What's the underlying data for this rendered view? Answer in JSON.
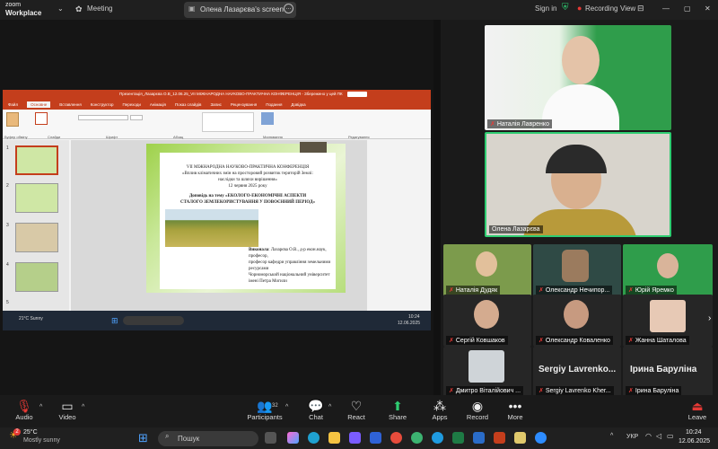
{
  "app": {
    "logo_line1": "zoom",
    "logo_line2": "Workplace",
    "meeting_label": "Meeting"
  },
  "topbar": {
    "share_label": "Олена Лазарєва's screen",
    "signin": "Sign in",
    "recording": "Recording",
    "view": "View"
  },
  "ppt": {
    "titlebar": "Презентація_Лазарєва О.В_12.06.25_VII МІЖНАРОДНА НАУКОВО-ПРАКТИЧНА КОНФЕРЕНЦІЯ - Збережено у цей ПК",
    "tabs": [
      "Файл",
      "Основне",
      "Вставлення",
      "Конструктор",
      "Переходи",
      "Анімація",
      "Показ слайдів",
      "Запис",
      "Рецензування",
      "Подання",
      "Довідка"
    ],
    "ribbon_groups": [
      "Буфер обміну",
      "Слайди",
      "Шрифт",
      "Абзац",
      "Малювання",
      "Редагування"
    ],
    "notes": "Нотатки до слайда",
    "status": "Слайд 1 з 27   Українська",
    "zoom": "62%",
    "slide": {
      "line1": "VII МІЖНАРОДНА НАУКОВО-ПРАКТИЧНА КОНФЕРЕНЦІЯ",
      "line2": "«Вплив кліматичних змін на просторовий розвиток територій Землі:",
      "line3": "наслідки та шляхи вирішення»",
      "line4": "12 червня 2025 року",
      "line5": "Доповідь на тему «ЕКОЛОГО-ЕКОНОМІЧНІ АСПЕКТИ",
      "line6": "СТАЛОГО ЗЕМЛЕКОРИСТУВАННЯ У ПОВОЄННИЙ ПЕРІОД»",
      "author_label": "Виконала",
      "author": ": Лазарєва О.В., д-р екон.наук,",
      "a2": "професор,",
      "a3": "професор кафедри управління земельними",
      "a4": "ресурсами",
      "a5": "Чорноморський національний університет",
      "a6": "імені Петра Могили"
    },
    "taskbar_weather": "21°C Sunny",
    "taskbar_time": "10:24",
    "taskbar_date": "12.06.2025"
  },
  "speakers": [
    {
      "name": "Наталія Лавренко"
    },
    {
      "name": "Олена Лазарєва"
    }
  ],
  "gallery": [
    {
      "name": "Наталія Дудяк"
    },
    {
      "name": "Олександр Нечипор..."
    },
    {
      "name": "Юрій Яремко"
    },
    {
      "name": "Сергій Ковшаков"
    },
    {
      "name": "Олександр Коваленко"
    },
    {
      "name": "Жанна Шаталова"
    },
    {
      "name": "Дмитро Віталійович ..."
    },
    {
      "name": "Sergiy Lavrenko Kher...",
      "big": "Sergiy Lavrenko..."
    },
    {
      "name": "Ірина Баруліна",
      "big": "Ірина Баруліна"
    }
  ],
  "controls": {
    "audio": "Audio",
    "video": "Video",
    "participants": "Participants",
    "participants_count": "32",
    "chat": "Chat",
    "react": "React",
    "share": "Share",
    "apps": "Apps",
    "record": "Record",
    "more": "More",
    "leave": "Leave"
  },
  "taskbar": {
    "temp": "25°C",
    "weather": "Mostly sunny",
    "search": "Пошук",
    "lang": "УКР",
    "time": "10:24",
    "date": "12.06.2025",
    "badge": "2"
  }
}
